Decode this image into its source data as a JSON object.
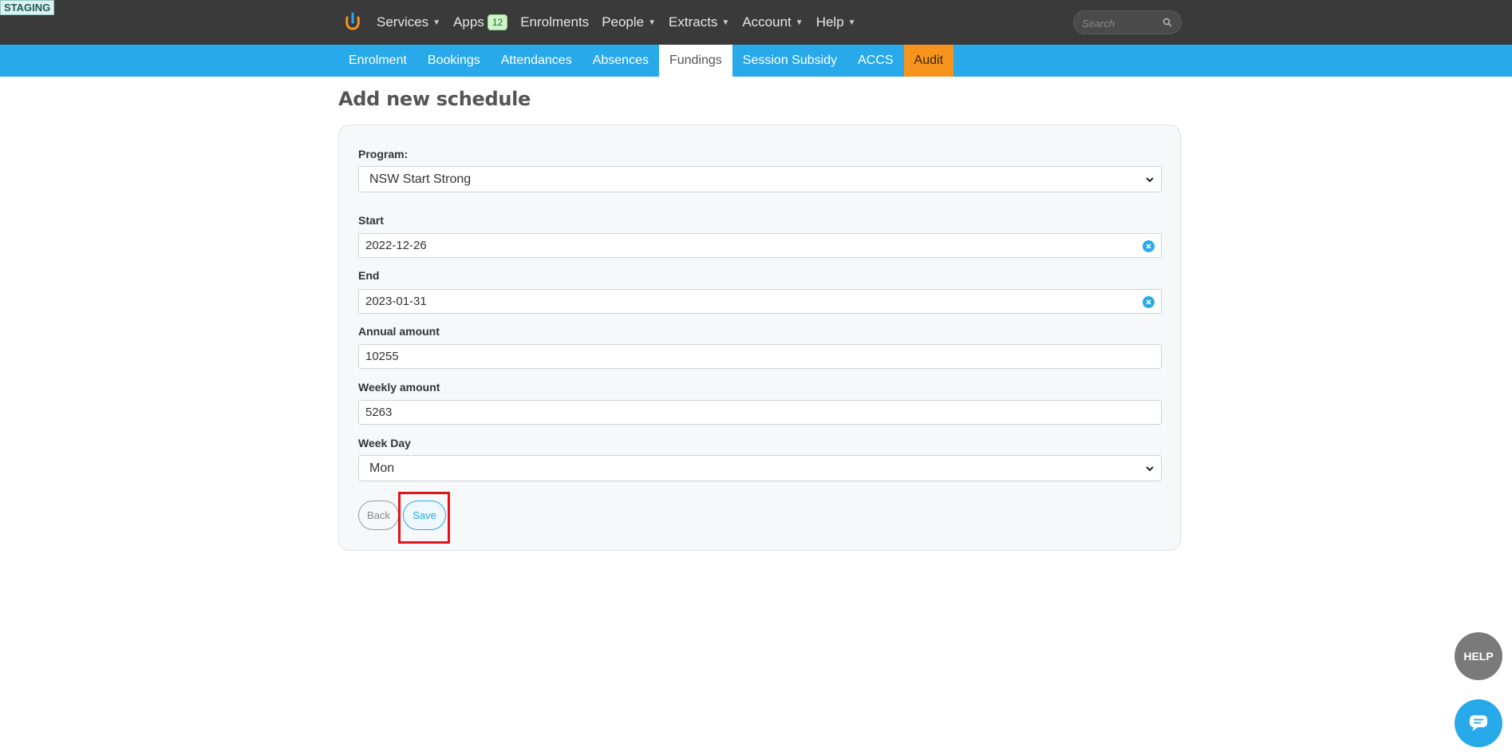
{
  "env_badge": "STAGING",
  "topnav": {
    "items": [
      {
        "label": "Services",
        "dropdown": true
      },
      {
        "label": "Apps",
        "badge": "12"
      },
      {
        "label": "Enrolments"
      },
      {
        "label": "People",
        "dropdown": true
      },
      {
        "label": "Extracts",
        "dropdown": true
      },
      {
        "label": "Account",
        "dropdown": true
      },
      {
        "label": "Help",
        "dropdown": true
      }
    ],
    "search_placeholder": "Search"
  },
  "subnav": {
    "tabs": [
      {
        "label": "Enrolment"
      },
      {
        "label": "Bookings"
      },
      {
        "label": "Attendances"
      },
      {
        "label": "Absences"
      },
      {
        "label": "Fundings",
        "active": true
      },
      {
        "label": "Session Subsidy"
      },
      {
        "label": "ACCS"
      },
      {
        "label": "Audit",
        "color": "#f7941d"
      }
    ]
  },
  "page": {
    "title": "Add new schedule"
  },
  "form": {
    "program_label": "Program:",
    "program_value": "NSW Start Strong",
    "start_label": "Start",
    "start_value": "2022-12-26",
    "end_label": "End",
    "end_value": "2023-01-31",
    "annual_label": "Annual amount",
    "annual_value": "10255",
    "weekly_label": "Weekly amount",
    "weekly_value": "5263",
    "weekday_label": "Week Day",
    "weekday_value": "Mon",
    "back_label": "Back",
    "save_label": "Save"
  },
  "help_fab_label": "HELP",
  "colors": {
    "topbar": "#3a3a3a",
    "accent": "#27a9ea",
    "audit": "#f7941d",
    "highlight": "#e3131b"
  }
}
